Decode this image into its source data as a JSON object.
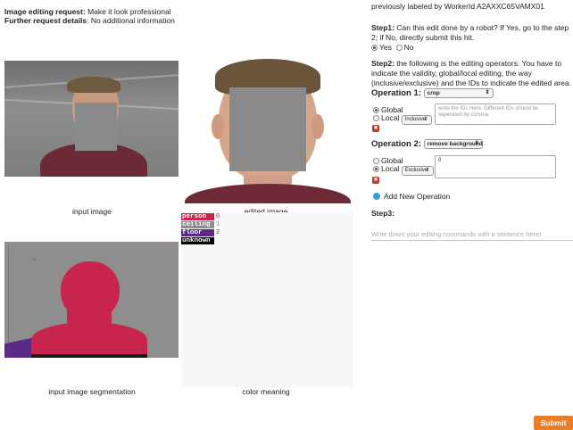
{
  "header": {
    "request_label": "Image editing request:",
    "request_value": "Make it look professional",
    "details_label": "Further request details",
    "details_value": ": No additional information"
  },
  "panels": {
    "input_caption": "input image",
    "edited_caption": "edited image",
    "segmentation_caption": "input image segmentation",
    "color_caption": "color meaning",
    "seg_marker": "0"
  },
  "legend": [
    {
      "name": "person",
      "index": "0",
      "color": "#c7254e",
      "num_color": "#c7254e"
    },
    {
      "name": "ceiling",
      "index": "1",
      "color": "#8e8e8e",
      "num_color": "#8e8e8e"
    },
    {
      "name": "floor",
      "index": "2",
      "color": "#5b2a86",
      "num_color": "#5b2a86"
    },
    {
      "name": "unknown",
      "index": "",
      "color": "#000000",
      "num_color": "#000000"
    }
  ],
  "right": {
    "previously_labeled": "previously labeled by WorkerId A2AXXC65VAMX01",
    "step1_label": "Step1:",
    "step1_text": " Can this edit done by a robot? If Yes, go to the step 2; if No, directly submit this hit.",
    "yes_label": "Yes",
    "no_label": "No",
    "step2_label": "Step2:",
    "step2_text": " the following is the editing operators. You have to indicate the validity, global/local editing, the way (inclusive/exclusive) and the IDs to indicate the edited area.",
    "op1_title": "Operation 1:",
    "op1_select": "crop",
    "op1_global": "Global",
    "op1_local": "Local",
    "op1_mode": "Inclusive",
    "op1_ids_placeholder": "write the IDs Here. Different IDs should be seperated by comma",
    "op2_title": "Operation 2:",
    "op2_select": "remove background",
    "op2_global": "Global",
    "op2_local": "Local",
    "op2_mode": "Exclusive",
    "op2_ids_value": "0",
    "add_operation": "Add New Operation",
    "step3_label": "Step3:",
    "step3_placeholder": "Write down your editing commands with a sentence here!",
    "submit": "Submit"
  }
}
